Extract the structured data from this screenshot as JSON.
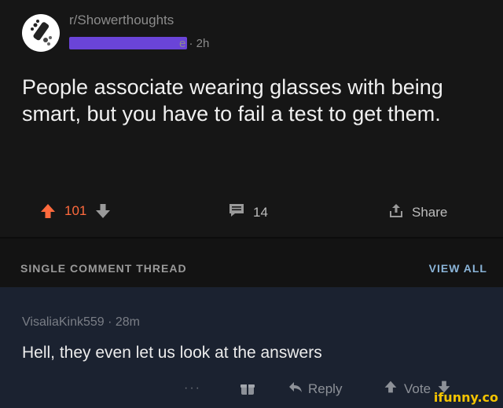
{
  "post": {
    "subreddit": "r/Showerthoughts",
    "meta_tail": "e · 2h",
    "title": "People associate wearing glasses with being smart, but you have to fail a test to get them.",
    "score": "101",
    "comments_count": "14",
    "share_label": "Share"
  },
  "thread": {
    "label": "SINGLE COMMENT THREAD",
    "view_all_label": "VIEW ALL"
  },
  "comment": {
    "author_meta": "VisaliaKink559 · 28m",
    "body": "Hell, they even let us look at the answers",
    "more_label": "···",
    "reply_label": "Reply",
    "vote_label": "Vote"
  },
  "watermark": "ifunny.co",
  "colors": {
    "upvote": "#ff6a3d",
    "redaction": "#6a44d8",
    "comment_bg": "#1b2230",
    "link": "#8ab4d8"
  }
}
